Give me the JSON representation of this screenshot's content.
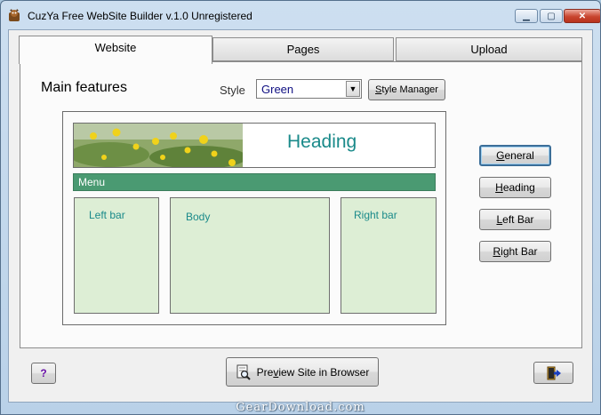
{
  "window": {
    "title": "CuzYa Free WebSite Builder v.1.0  Unregistered",
    "controls": {
      "minimize": "▁",
      "maximize": "▢",
      "close": "✕"
    }
  },
  "tabs": [
    {
      "label": "Website",
      "active": true
    },
    {
      "label": "Pages",
      "active": false
    },
    {
      "label": "Upload",
      "active": false
    }
  ],
  "main": {
    "heading": "Main features",
    "style_label": "Style",
    "style_value": "Green",
    "style_manager_first": "S",
    "style_manager_rest": "tyle Manager"
  },
  "preview": {
    "heading": "Heading",
    "menu": "Menu",
    "left_bar": "Left bar",
    "body": "Body",
    "right_bar": "Right bar",
    "colors": {
      "menu": "#4a9a72",
      "boxes": "#ddeed5",
      "text": "#1a8a8a"
    }
  },
  "side_buttons": {
    "general": {
      "pre": "",
      "u": "G",
      "post": "eneral"
    },
    "heading": {
      "pre": "",
      "u": "H",
      "post": "eading"
    },
    "left_bar": {
      "pre": "",
      "u": "L",
      "post": "eft Bar"
    },
    "right_bar": {
      "pre": "",
      "u": "R",
      "post": "ight Bar"
    }
  },
  "bottom": {
    "help": "?",
    "preview_pre": "Pre",
    "preview_u": "v",
    "preview_post": "iew Site in Browser"
  },
  "watermark": "GearDownload.com"
}
